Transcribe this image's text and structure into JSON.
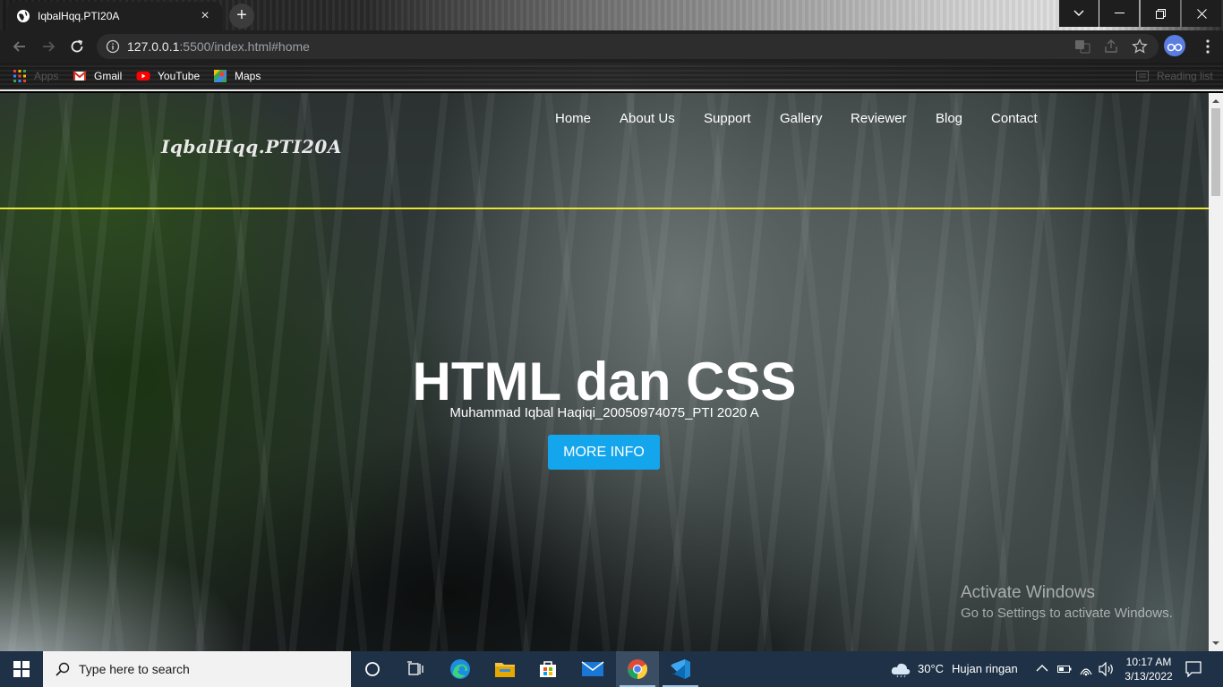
{
  "browser": {
    "tab_title": "IqbalHqq.PTI20A",
    "tab_close": "×",
    "new_tab": "+",
    "url_host": "127.0.0.1",
    "url_rest": ":5500/index.html#home",
    "bookmarks": [
      {
        "label": "Apps",
        "icon": "apps-grid-icon"
      },
      {
        "label": "Gmail",
        "icon": "gmail-icon"
      },
      {
        "label": "YouTube",
        "icon": "youtube-icon"
      },
      {
        "label": "Maps",
        "icon": "maps-icon"
      }
    ],
    "reading_list": "Reading list"
  },
  "page": {
    "nav": [
      "Home",
      "About Us",
      "Support",
      "Gallery",
      "Reviewer",
      "Blog",
      "Contact"
    ],
    "brand": "IqbalHqq.PTI20A",
    "hero_title": "HTML dan CSS",
    "hero_subtitle": "Muhammad Iqbal Haqiqi_20050974075_PTI 2020 A",
    "hero_button": "MORE INFO",
    "divider_color": "#e6e633",
    "button_color": "#14a6ed"
  },
  "watermark": {
    "title": "Activate Windows",
    "subtitle": "Go to Settings to activate Windows."
  },
  "taskbar": {
    "search_placeholder": "Type here to search",
    "weather_temp": "30°C",
    "weather_desc": "Hujan ringan",
    "time": "10:17 AM",
    "date": "3/13/2022",
    "apps": [
      "task-view-icon",
      "edge-icon",
      "file-explorer-icon",
      "store-icon",
      "mail-icon",
      "chrome-icon",
      "vscode-icon"
    ]
  }
}
